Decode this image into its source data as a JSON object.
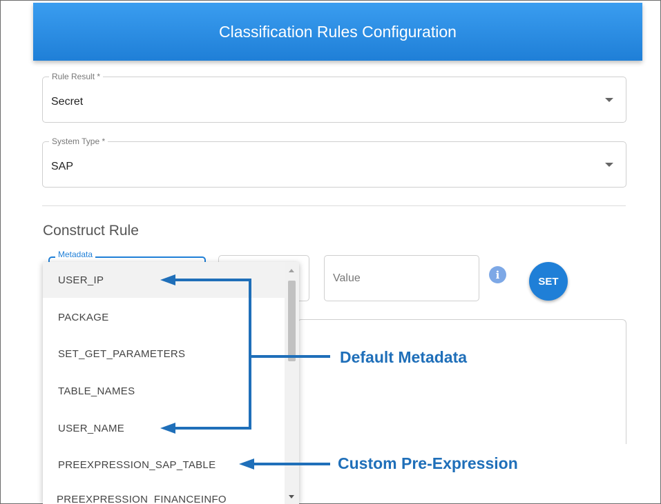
{
  "header": {
    "title": "Classification Rules Configuration"
  },
  "rule_result": {
    "label": "Rule Result *",
    "value": "Secret"
  },
  "system_type": {
    "label": "System Type *",
    "value": "SAP"
  },
  "construct_rule": {
    "title": "Construct Rule",
    "metadata_label": "Metadata",
    "value_placeholder": "Value",
    "info_icon": "info-icon",
    "set_label": "SET"
  },
  "dropdown": {
    "items": [
      "USER_IP",
      "PACKAGE",
      "SET_GET_PARAMETERS",
      "TABLE_NAMES",
      "USER_NAME",
      "PREEXPRESSION_SAP_TABLE",
      "PREEXPRESSION_FINANCEINFO"
    ]
  },
  "annotations": {
    "default_metadata": "Default Metadata",
    "custom_pre_expression": "Custom Pre-Expression"
  },
  "colors": {
    "primary": "#1f7fd7",
    "annotation": "#1f6fb9",
    "info": "#7da8e6"
  }
}
